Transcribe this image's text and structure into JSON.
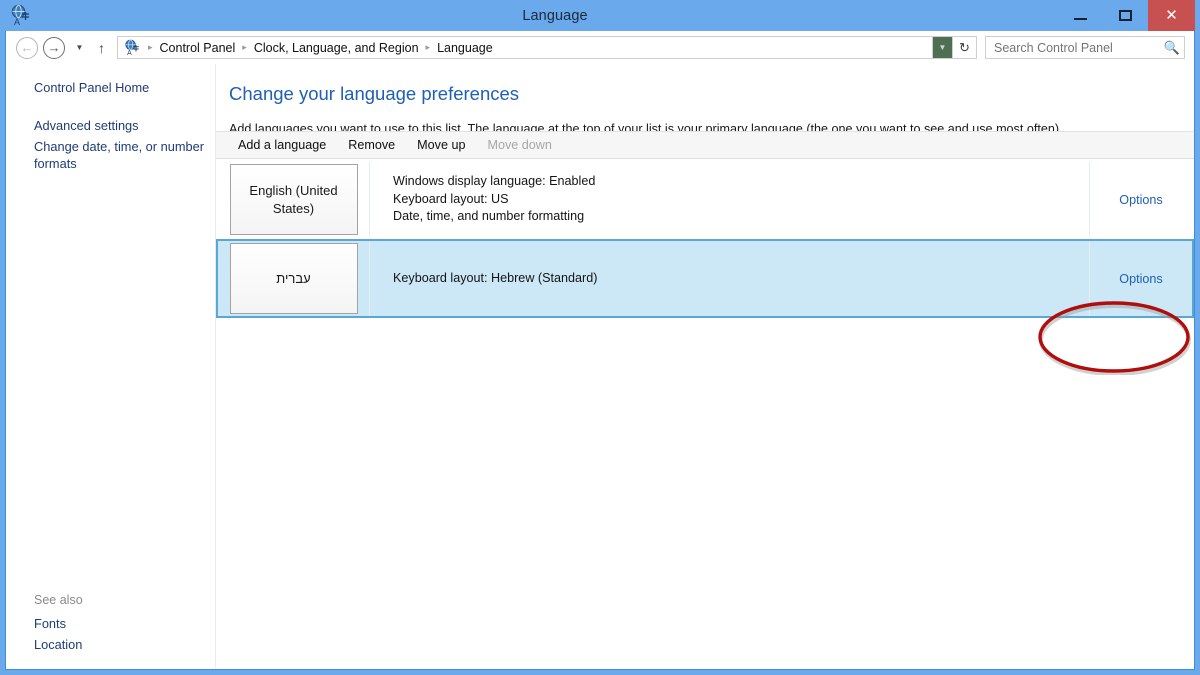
{
  "window": {
    "title": "Language",
    "icon": "language-globe-icon",
    "accent_color": "#6aa9ec",
    "close_button_color": "#c75050",
    "controls": {
      "minimize": "minimize-button",
      "maximize": "maximize-button",
      "close": "close-button"
    }
  },
  "addressbar": {
    "back": "back-button",
    "forward": "forward-button",
    "recent_pages": "recent-pages-dropdown",
    "up": "up-one-level-button",
    "breadcrumbs": [
      "Control Panel",
      "Clock, Language, and Region",
      "Language"
    ],
    "separator": "▸",
    "path_dropdown": "previous-locations-dropdown",
    "refresh": "↻",
    "search": {
      "placeholder": "Search Control Panel",
      "value": "",
      "icon": "search-icon"
    }
  },
  "sidebar": {
    "links": [
      {
        "label": "Control Panel Home"
      },
      {
        "label": "Advanced settings"
      },
      {
        "label": "Change date, time, or number formats"
      }
    ],
    "see_also": {
      "title": "See also",
      "links": [
        {
          "label": "Fonts"
        },
        {
          "label": "Location"
        }
      ]
    }
  },
  "main": {
    "heading": "Change your language preferences",
    "description": "Add languages you want to use to this list. The language at the top of your list is your primary language (the one you want to see and use most often).",
    "toolbar": [
      {
        "label": "Add a language",
        "enabled": true
      },
      {
        "label": "Remove",
        "enabled": true
      },
      {
        "label": "Move up",
        "enabled": true
      },
      {
        "label": "Move down",
        "enabled": false
      }
    ],
    "languages": [
      {
        "name": "English (United States)",
        "details": [
          "Windows display language: Enabled",
          "Keyboard layout: US",
          "Date, time, and number formatting"
        ],
        "options_label": "Options",
        "selected": false
      },
      {
        "name": "עברית",
        "details": [
          "Keyboard layout: Hebrew (Standard)"
        ],
        "options_label": "Options",
        "selected": true
      }
    ]
  },
  "annotation": {
    "shape": "ellipse",
    "color": "#b00d0d",
    "target": "Options"
  }
}
